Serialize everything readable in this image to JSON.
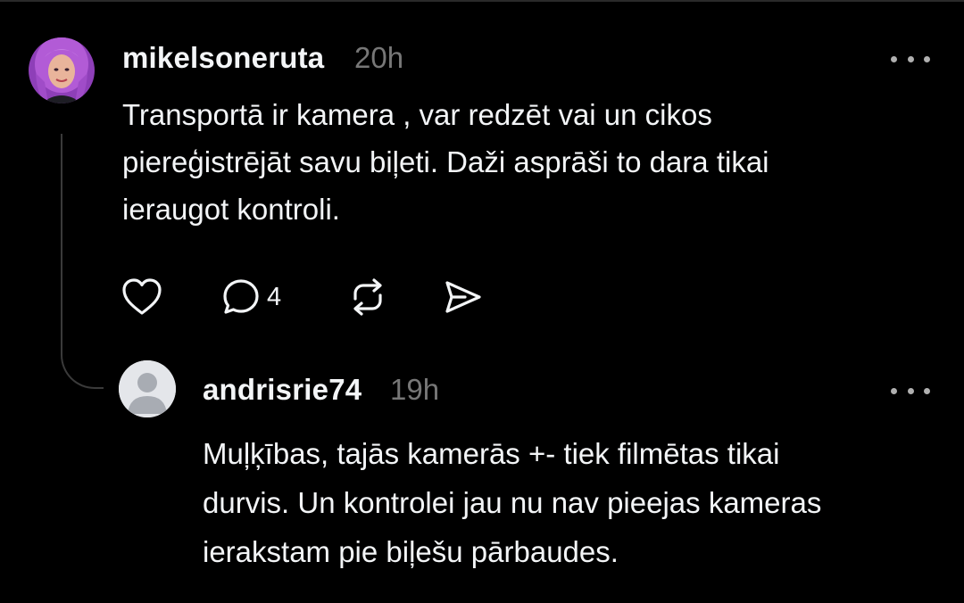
{
  "post": {
    "username": "mikelsoneruta",
    "timestamp": "20h",
    "text_lines": [
      "Transportā ir kamera , var redzēt vai un cikos",
      "piereģistrējāt savu biļeti. Daži asprāši to dara tikai",
      "ieraugot kontroli."
    ],
    "reply_count": "4",
    "icons": {
      "like": "heart-icon",
      "comment": "comment-icon",
      "repost": "repost-icon",
      "share": "share-icon",
      "more": "more-icon"
    }
  },
  "reply": {
    "username": "andrisrie74",
    "timestamp": "19h",
    "text_lines": [
      "Muļķības, tajās kamerās +- tiek filmētas tikai",
      "durvis. Un kontrolei jau nu nav pieejas kameras",
      "ierakstam pie biļešu pārbaudes."
    ]
  },
  "colors": {
    "background": "#000000",
    "text": "#f3f5f7",
    "secondary_text": "#777777",
    "thread_line": "#3a3a3a",
    "avatar_hair": "#b25bd6"
  }
}
